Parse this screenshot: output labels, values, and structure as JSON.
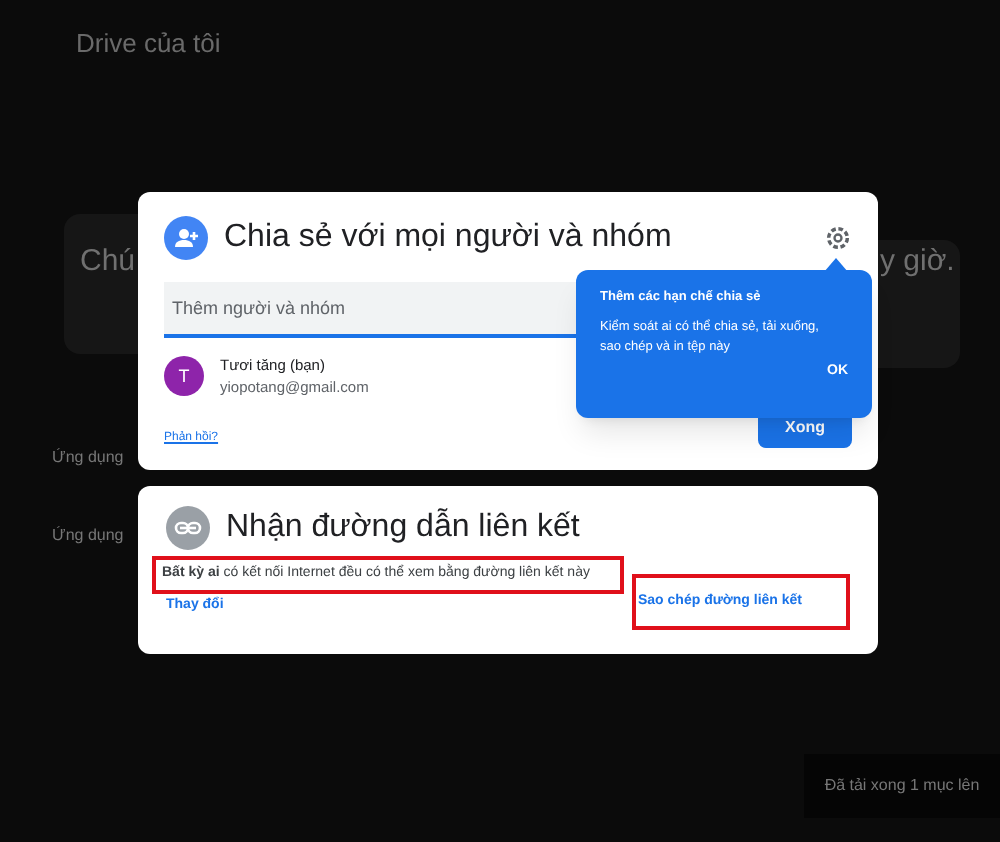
{
  "background": {
    "title": "Drive của tôi",
    "banner_start": "Chú",
    "banner_end": "y giờ.",
    "side_labels": [
      "Ứng dụng",
      "Ứng dụng"
    ],
    "toast": "Đã tải xong 1 mục lên"
  },
  "share_dialog": {
    "title": "Chia sẻ với mọi người và nhóm",
    "input": {
      "placeholder": "Thêm người và nhóm"
    },
    "people": [
      {
        "initial": "T",
        "name": "Tươi tăng (bạn)",
        "email": "yiopotang@gmail.com",
        "color": "#8e24aa"
      }
    ],
    "feedback_link": "Phản hồi?",
    "done_button": "Xong"
  },
  "tooltip": {
    "title": "Thêm các hạn chế chia sẻ",
    "body": "Kiểm soát ai có thể chia sẻ, tải xuống, sao chép và in tệp này",
    "ok": "OK"
  },
  "link_dialog": {
    "title": "Nhận đường dẫn liên kết",
    "description": "**Bất kỳ ai** có kết nối Internet đều có thể xem bằng đường liên kết này",
    "change_link": "Thay đổi",
    "copy_link": "Sao chép đường liên kết"
  }
}
